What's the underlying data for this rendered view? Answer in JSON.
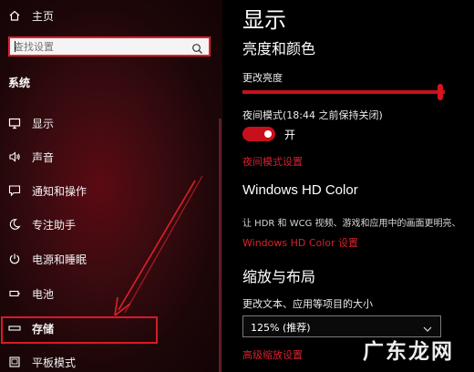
{
  "sidebar": {
    "home_label": "主页",
    "search_placeholder": "查找设置",
    "section_title": "系统",
    "items": [
      {
        "label": "显示",
        "icon": "monitor-icon"
      },
      {
        "label": "声音",
        "icon": "speaker-icon"
      },
      {
        "label": "通知和操作",
        "icon": "message-icon"
      },
      {
        "label": "专注助手",
        "icon": "moon-icon"
      },
      {
        "label": "电源和睡眠",
        "icon": "power-icon"
      },
      {
        "label": "电池",
        "icon": "battery-icon"
      },
      {
        "label": "存储",
        "icon": "storage-icon"
      },
      {
        "label": "平板模式",
        "icon": "tablet-icon"
      }
    ]
  },
  "main": {
    "page_title": "显示",
    "brightness_heading": "亮度和颜色",
    "brightness_label": "更改亮度",
    "brightness_value": 0.97,
    "night_light_label": "夜间模式(18:44 之前保持关闭)",
    "night_light_state": "开",
    "night_light_link": "夜间模式设置",
    "hdr_heading": "Windows HD Color",
    "hdr_desc": "让 HDR 和 WCG 视频、游戏和应用中的画面更明亮、",
    "hdr_link": "Windows HD Color 设置",
    "scale_heading": "缩放与布局",
    "scale_label": "更改文本、应用等项目的大小",
    "scale_value": "125% (推荐)",
    "advanced_scale_link": "高级缩放设置"
  },
  "watermark": "广东龙网",
  "colors": {
    "accent": "#c8101d",
    "link": "#d7212c",
    "highlight": "#d81a27"
  }
}
